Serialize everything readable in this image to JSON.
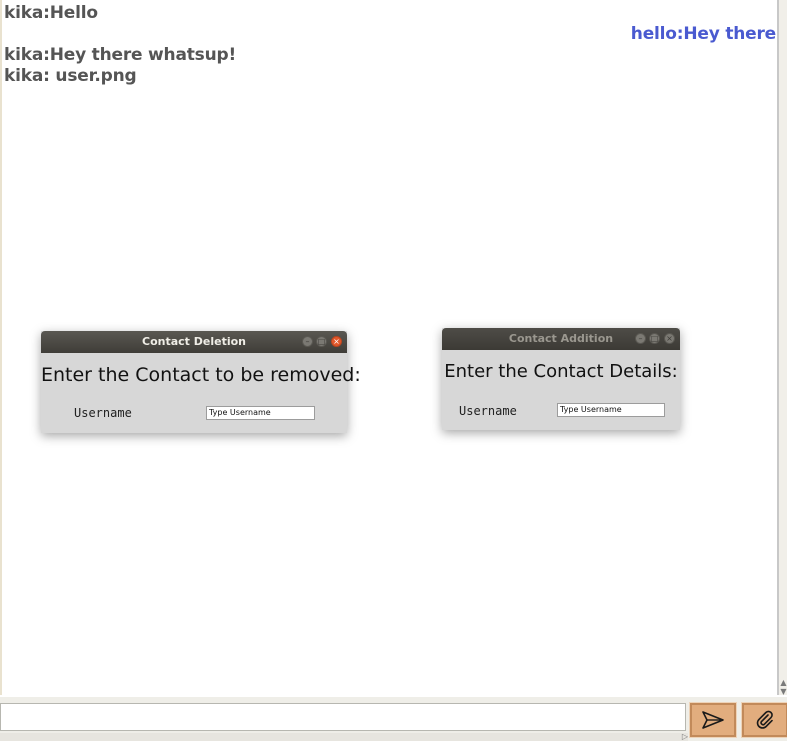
{
  "chat": {
    "messages": [
      {
        "text": "kika:Hello",
        "direction": "incoming"
      },
      {
        "text": "hello:Hey there",
        "direction": "outgoing"
      },
      {
        "text": "kika:Hey there whatsup!",
        "direction": "incoming"
      },
      {
        "text": "kika: user.png",
        "direction": "incoming"
      }
    ]
  },
  "composer": {
    "value": "",
    "send_icon": "send-icon",
    "attach_icon": "paperclip-icon"
  },
  "dialogs": {
    "deletion": {
      "title": "Contact Deletion",
      "prompt": "Enter the Contact to be removed:",
      "username_label": "Username",
      "username_value": "Type Username",
      "active": true
    },
    "addition": {
      "title": "Contact Addition",
      "prompt": "Enter the Contact Details:",
      "username_label": "Username",
      "username_value": "Type Username",
      "active": false
    }
  },
  "colors": {
    "incoming_text": "#555555",
    "outgoing_text": "#4a5ad0",
    "button_fill": "#e2ad7e",
    "close_button": "#e3582b"
  }
}
